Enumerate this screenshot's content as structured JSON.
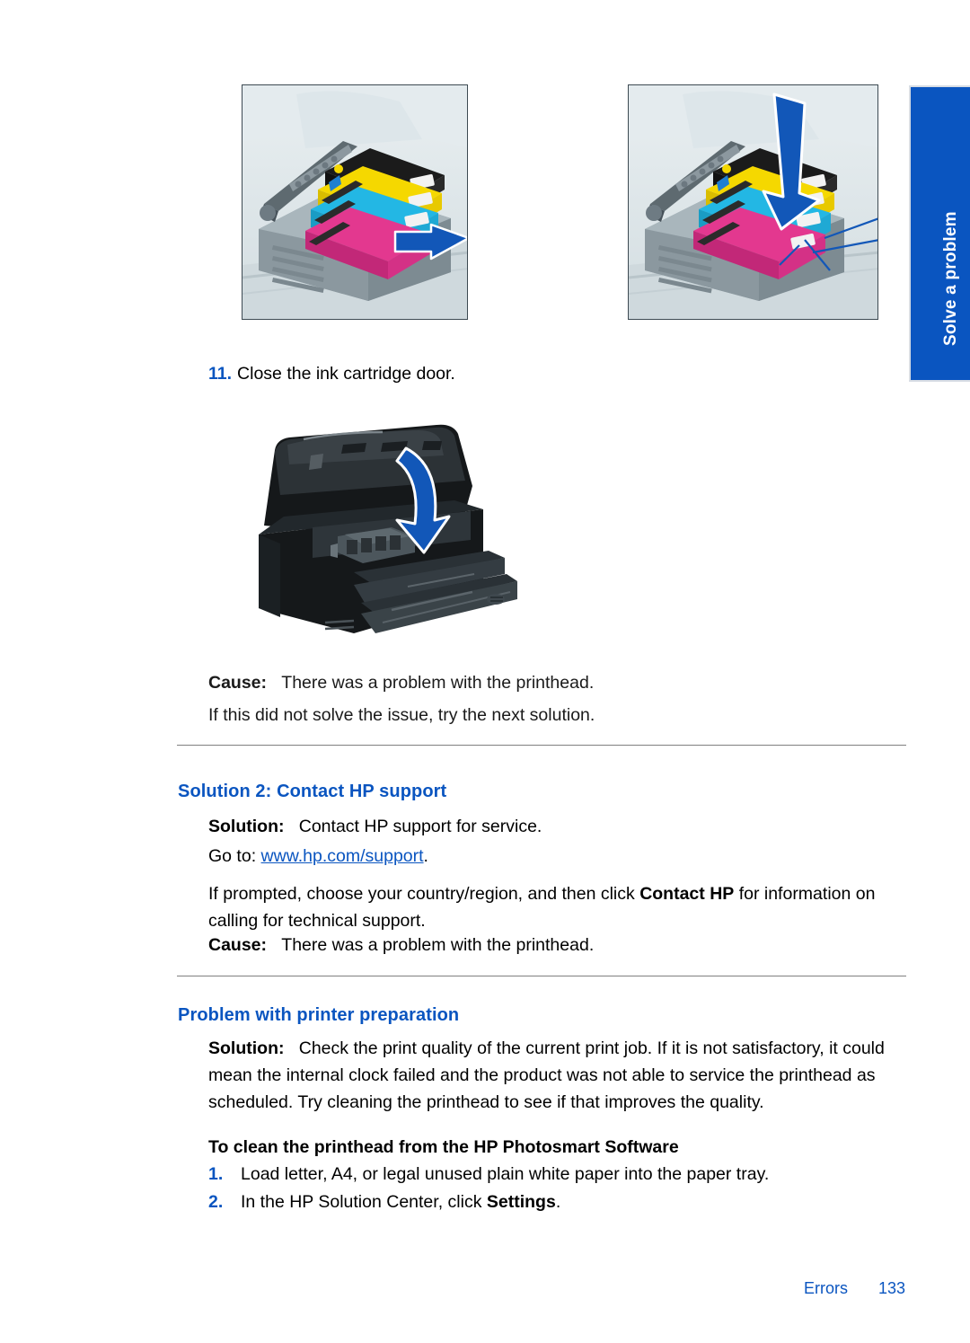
{
  "side_tab": {
    "label": "Solve a problem",
    "color": "#0A55C0"
  },
  "figures": {
    "cartridges_open": {
      "name": "ink-cartridge-carriage-with-arrow",
      "arrow_direction": "left"
    },
    "cartridges_press": {
      "name": "ink-cartridge-carriage-press-down",
      "arrow_direction": "down"
    },
    "printer_close_lid": {
      "name": "printer-close-ink-cartridge-door",
      "arrow_direction": "curved-down"
    }
  },
  "step": {
    "number": "11.",
    "text": "Close the ink cartridge door."
  },
  "cause_first": {
    "label": "Cause:",
    "text": "There was a problem with the printhead.",
    "followup": "If this did not solve the issue, try the next solution."
  },
  "solution2": {
    "heading": "Solution 2: Contact HP support",
    "solution_label": "Solution:",
    "solution_text": "Contact HP support for service.",
    "goto_prefix": "Go to:",
    "goto_link": "www.hp.com/support",
    "goto_suffix": ".",
    "prompt_text_1": "If prompted, choose your country/region, and then click ",
    "prompt_bold": "Contact HP",
    "prompt_text_2": " for information on calling for technical support.",
    "cause_label": "Cause:",
    "cause_text": "There was a problem with the printhead."
  },
  "printer_prep": {
    "heading": "Problem with printer preparation",
    "solution_label": "Solution:",
    "solution_text": "Check the print quality of the current print job. If it is not satisfactory, it could mean the internal clock failed and the product was not able to service the printhead as scheduled. Try cleaning the printhead to see if that improves the quality.",
    "procedure_heading": "To clean the printhead from the HP Photosmart Software",
    "steps": [
      {
        "marker": "1.",
        "text": "Load letter, A4, or legal unused plain white paper into the paper tray."
      },
      {
        "marker": "2.",
        "text_before": "In the HP Solution Center, click ",
        "bold": "Settings",
        "text_after": "."
      }
    ]
  },
  "footer": {
    "label": "Errors",
    "page": "133"
  }
}
